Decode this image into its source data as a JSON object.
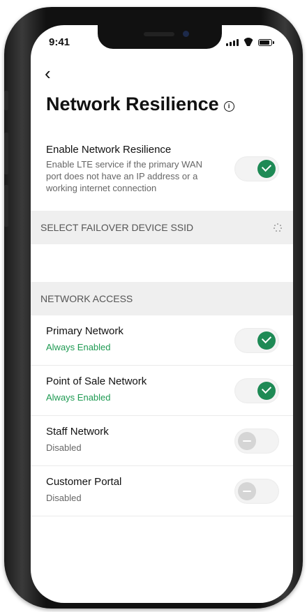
{
  "status_bar": {
    "time": "9:41"
  },
  "header": {
    "back_glyph": "‹",
    "title": "Network Resilience",
    "info_glyph": "i"
  },
  "enable": {
    "title": "Enable Network Resilience",
    "description": "Enable LTE service if the primary WAN port does not have an IP address or a working internet connection",
    "enabled": true
  },
  "failover": {
    "header": "SELECT FAILOVER DEVICE SSID",
    "loading": true
  },
  "network_access": {
    "header": "NETWORK ACCESS",
    "items": [
      {
        "label": "Primary Network",
        "status": "Always Enabled",
        "enabled": true
      },
      {
        "label": "Point of Sale Network",
        "status": "Always Enabled",
        "enabled": true
      },
      {
        "label": "Staff Network",
        "status": "Disabled",
        "enabled": false
      },
      {
        "label": "Customer Portal",
        "status": "Disabled",
        "enabled": false
      }
    ]
  },
  "colors": {
    "accent": "#1e8a55",
    "status_enabled": "#1e9a52",
    "section_bg": "#efefef"
  },
  "icons": [
    "back-chevron-icon",
    "info-icon",
    "signal-icon",
    "wifi-icon",
    "battery-icon",
    "check-icon",
    "loading-spinner-icon"
  ]
}
